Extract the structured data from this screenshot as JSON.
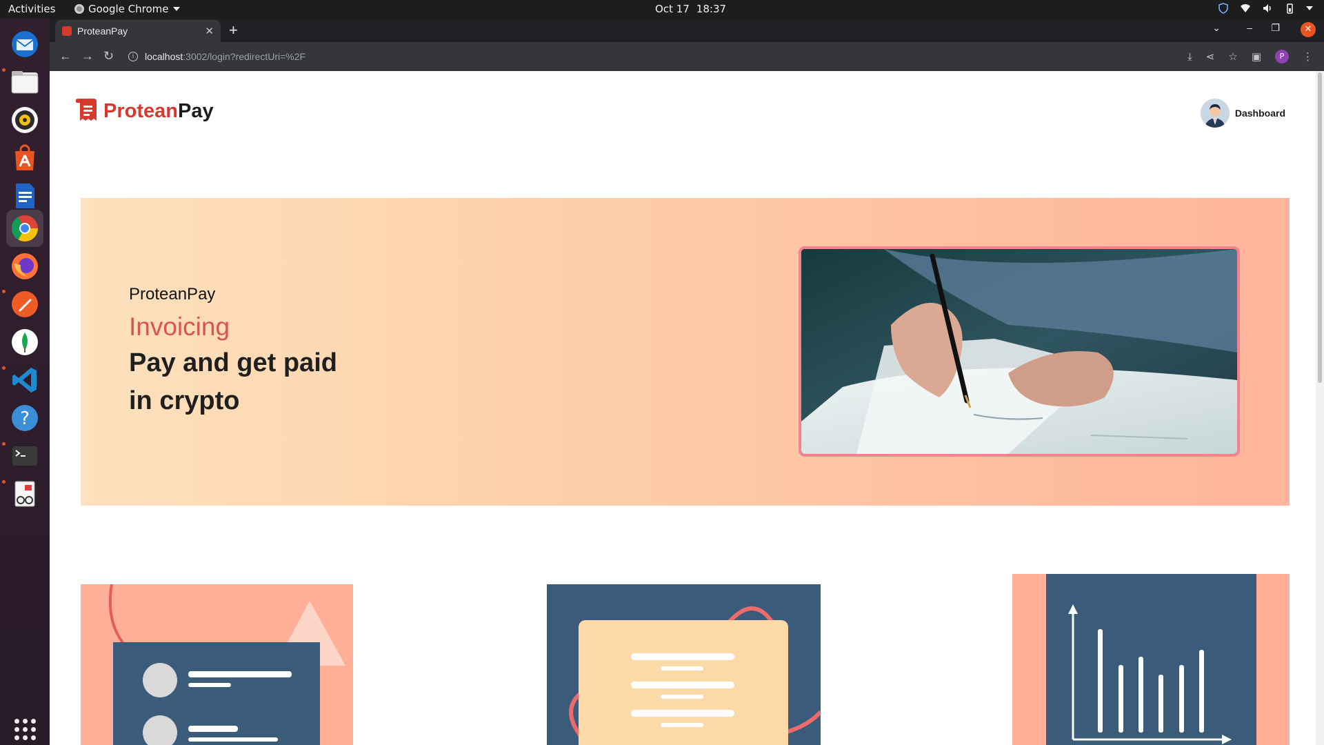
{
  "system_bar": {
    "activities": "Activities",
    "app_name": "Google Chrome",
    "date": "Oct 17",
    "time": "18:37"
  },
  "dock": {
    "apps": [
      "thunderbird-icon",
      "files-icon",
      "rhythmbox-icon",
      "app-center-icon",
      "writer-icon",
      "chrome-icon",
      "firefox-icon",
      "postman-icon",
      "mongodb-compass-icon",
      "vscode-icon",
      "help-icon",
      "terminal-icon",
      "document-viewer-icon"
    ],
    "show_apps": "show-apps-icon"
  },
  "browser": {
    "tab_title": "ProteanPay",
    "url_host": "localhost",
    "url_rest": ":3002/login?redirectUri=%2F",
    "profile_initial": "P"
  },
  "header": {
    "logo_part1": "Protean",
    "logo_part2": "Pay",
    "dashboard_label": "Dashboard"
  },
  "hero": {
    "brand": "ProteanPay",
    "subtitle": "Invoicing",
    "headline_line1": "Pay and get paid",
    "headline_line2": "in crypto"
  },
  "colors": {
    "brand_red": "#d63a2e",
    "accent_coral": "#d6554d",
    "navy": "#3b5b7a",
    "peach": "#ffae97",
    "cream": "#fdd9a8"
  }
}
